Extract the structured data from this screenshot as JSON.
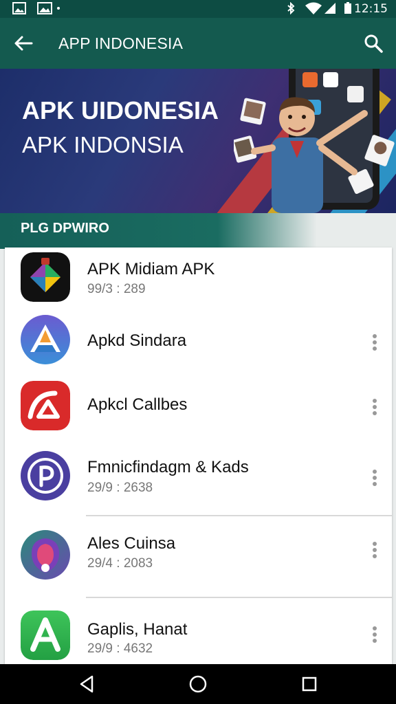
{
  "status_bar": {
    "time": "12:15"
  },
  "app_bar": {
    "title": "APP INDONESIA"
  },
  "banner": {
    "headline": "APK UIDONESIA",
    "subheadline": "APK INDONSIA"
  },
  "section": {
    "label": "PLG DPWIRO"
  },
  "apps": [
    {
      "name": "APK Midiam APK",
      "meta": "99/3 : 289",
      "icon": "colorful-diamond-icon"
    },
    {
      "name": "Apkd Sindara",
      "meta": "",
      "icon": "blue-triangle-a-icon"
    },
    {
      "name": "Apkcl Callbes",
      "meta": "",
      "icon": "red-arc-icon"
    },
    {
      "name": "Fmnicfindagm & Kads",
      "meta": "29/9 : 2638",
      "icon": "purple-p-icon"
    },
    {
      "name": "Ales Cuinsa",
      "meta": "29/4 : 2083",
      "icon": "purple-shield-icon"
    },
    {
      "name": "Gaplis, Hanat",
      "meta": "29/9 : 4632",
      "icon": "green-a-icon"
    }
  ],
  "colors": {
    "app_bar": "#145a4f",
    "status_bar": "#0d4c43",
    "accent_green": "#1a6c61"
  }
}
